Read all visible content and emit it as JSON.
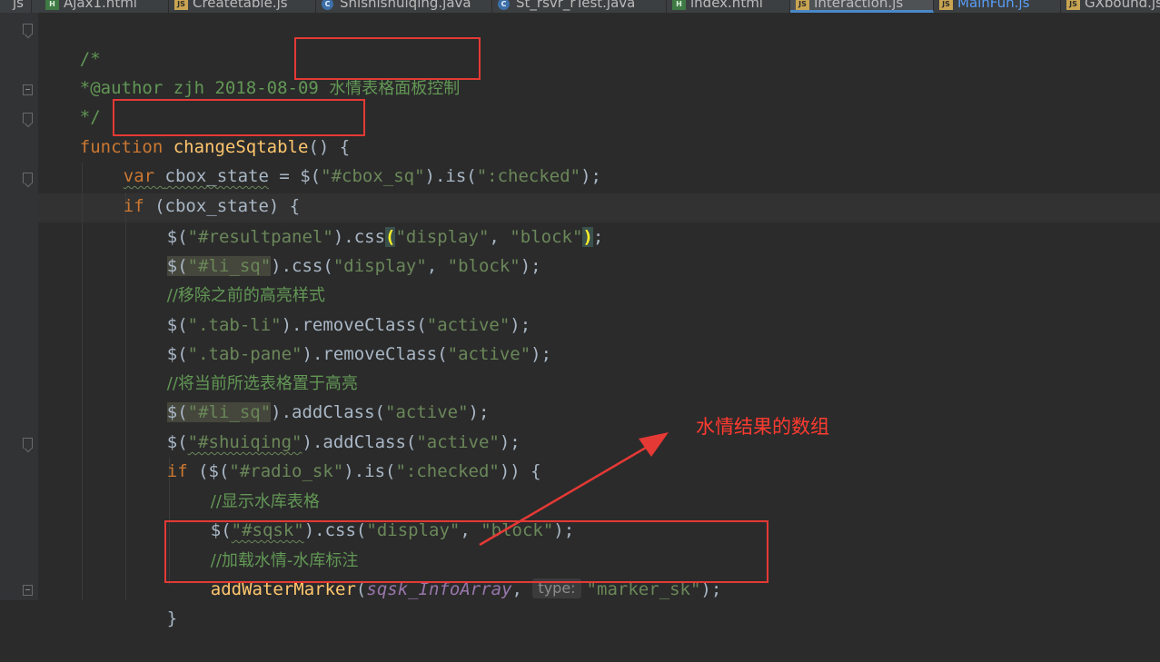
{
  "tabs": [
    {
      "label": "js",
      "type": "js",
      "file_icon": "js-file-icon"
    },
    {
      "label": "Ajax1.html",
      "type": "html",
      "file_icon": "html-file-icon"
    },
    {
      "label": "Createtable.js",
      "type": "js",
      "file_icon": "js-file-icon"
    },
    {
      "label": "Shishishuiqing.java",
      "type": "java",
      "file_icon": "java-class-icon"
    },
    {
      "label": "St_rsvr_rTest.java",
      "type": "java",
      "file_icon": "java-class-icon"
    },
    {
      "label": "index.html",
      "type": "html",
      "file_icon": "html-file-icon"
    },
    {
      "label": "Interaction.js",
      "type": "js",
      "file_icon": "js-file-icon",
      "active": true
    },
    {
      "label": "MainFun.js",
      "type": "js",
      "file_icon": "js-file-icon"
    },
    {
      "label": "GXbound.js",
      "type": "js",
      "file_icon": "js-file-icon"
    }
  ],
  "code": {
    "doc_open": "/*",
    "author_prefix": "*@author zjh 2018-08-09 ",
    "author_title": "水情表格面板控制",
    "doc_close": "*/",
    "function_kw": "function ",
    "function_name": "changeSqtable",
    "function_sig_rest": "() {",
    "var_kw": "var ",
    "var_name": "cbox_state",
    "var_eq": " = $(",
    "str_cbox": "\"#cbox_sq\"",
    "dot_is": ").is(",
    "str_checked": "\":checked\"",
    "close_semi": ");",
    "if_kw": "if ",
    "if_cond": "(cbox_state) {",
    "dollar_open": "$(",
    "str_resultpanel": "\"#resultpanel\"",
    "dot_css": ").css",
    "paren_open": "(",
    "str_display": "\"display\"",
    "comma": ", ",
    "str_block": "\"block\"",
    "paren_close": ")",
    "semi": ";",
    "str_li_sq": "\"#li_sq\"",
    "dot_css_open": ").css(",
    "comment_remove": "//移除之前的高亮样式",
    "str_tab_li": "\".tab-li\"",
    "dot_removeclass": ").removeClass(",
    "str_active": "\"active\"",
    "str_tab_pane": "\".tab-pane\"",
    "comment_set": "//将当前所选表格置于高亮",
    "dot_addclass": ").addClass(",
    "str_shuiqing": "\"#shuiqing\"",
    "if_open": "($(",
    "str_radio_sk": "\"#radio_sk\"",
    "close_block": ")) {",
    "comment_show": "//显示水库表格",
    "str_sqsk": "\"#sqsk\"",
    "comment_load": "//加载水情-水库标注",
    "call_name": "addWaterMarker",
    "param_name": "sqsk_InfoArray",
    "hint_label": "type:",
    "str_marker": "\"marker_sk\"",
    "closing_brace": "}"
  },
  "annotation": {
    "label": "水情结果的数组",
    "color": "#e53935"
  },
  "colors": {
    "editor_bg": "#2b2b2b",
    "gutter_bg": "#313335",
    "keyword": "#cc7832",
    "function": "#ffc66d",
    "string": "#6a8759",
    "comment": "#629755",
    "param": "#9876aa",
    "active_tab_underline": "#4a88c7"
  }
}
